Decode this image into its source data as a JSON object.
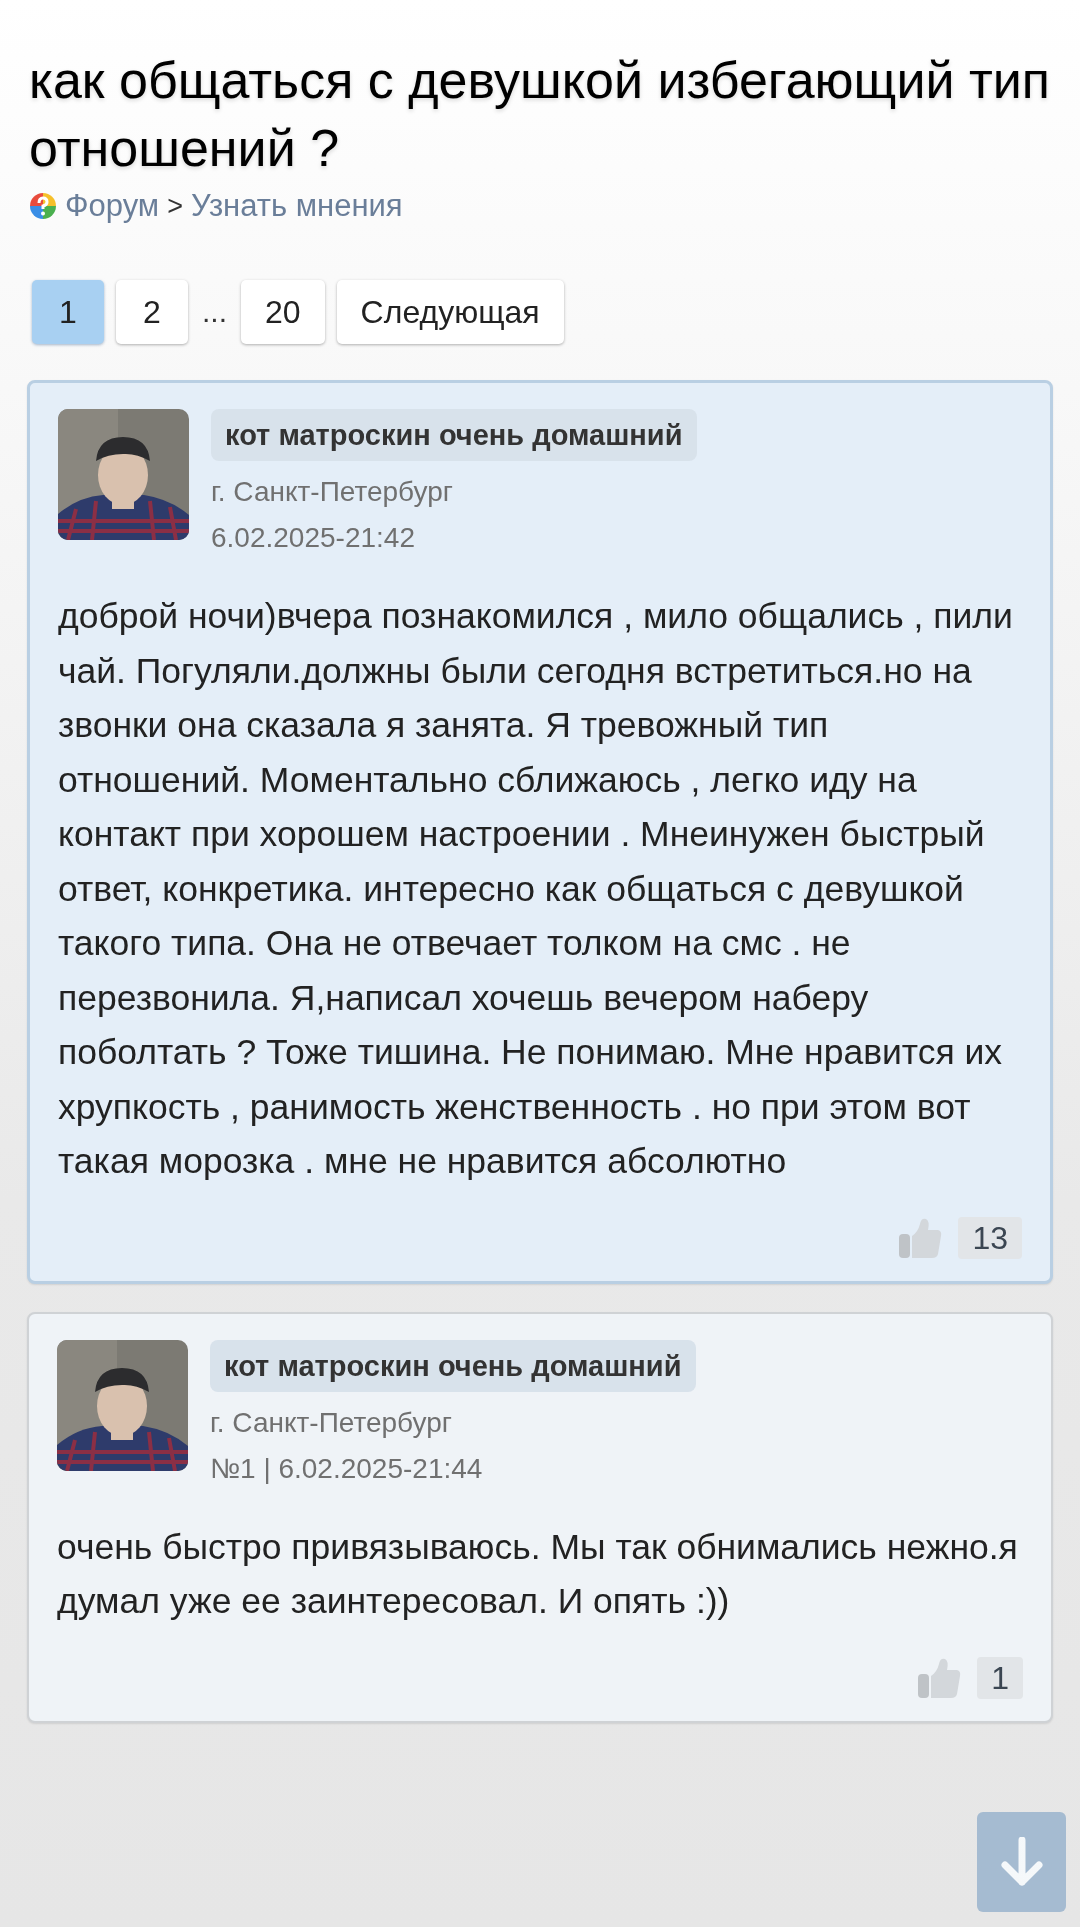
{
  "title": "как общаться с девушкой избегающий тип отношений ?",
  "breadcrumb": {
    "items": [
      "Форум",
      "Узнать мнения"
    ],
    "separator": ">"
  },
  "pagination": [
    {
      "kind": "page",
      "label": "1",
      "selected": true
    },
    {
      "kind": "page",
      "label": "2",
      "selected": false
    },
    {
      "kind": "gap",
      "label": "..."
    },
    {
      "kind": "page",
      "label": "20",
      "selected": false
    },
    {
      "kind": "next",
      "label": "Следующая"
    }
  ],
  "posts": [
    {
      "highlighted": true,
      "author": "кот матроскин очень домашний",
      "city": "г. Санкт-Петербург",
      "meta": "6.02.2025-21:42",
      "text": "доброй ночи)вчера познакомился , мило общались , пили чай. Погуляли.должны были сегодня встретиться.но на звонки она сказала я занята. Я тревожный тип отношений. Моментально сближаюсь , легко иду на контакт при хорошем настроении . Мнеинужен быстрый ответ, конкретика. интересно как общаться с девушкой такого типа. Она не отвечает толком на смс . не перезвонила. Я,написал хочешь вечером наберу поболтать ? Тоже тишина. Не понимаю. Мне нравится их хрупкость , ранимость женственность . но при этом вот такая морозка . мне не нравится абсолютно",
      "likes": "13"
    },
    {
      "highlighted": false,
      "author": "кот матроскин очень домашний",
      "city": "г. Санкт-Петербург",
      "meta": "№1 | 6.02.2025-21:44",
      "text": "очень быстро привязываюсь. Мы так обнимались нежно.я думал уже ее заинтересовал. И опять :))",
      "likes": "1"
    }
  ]
}
